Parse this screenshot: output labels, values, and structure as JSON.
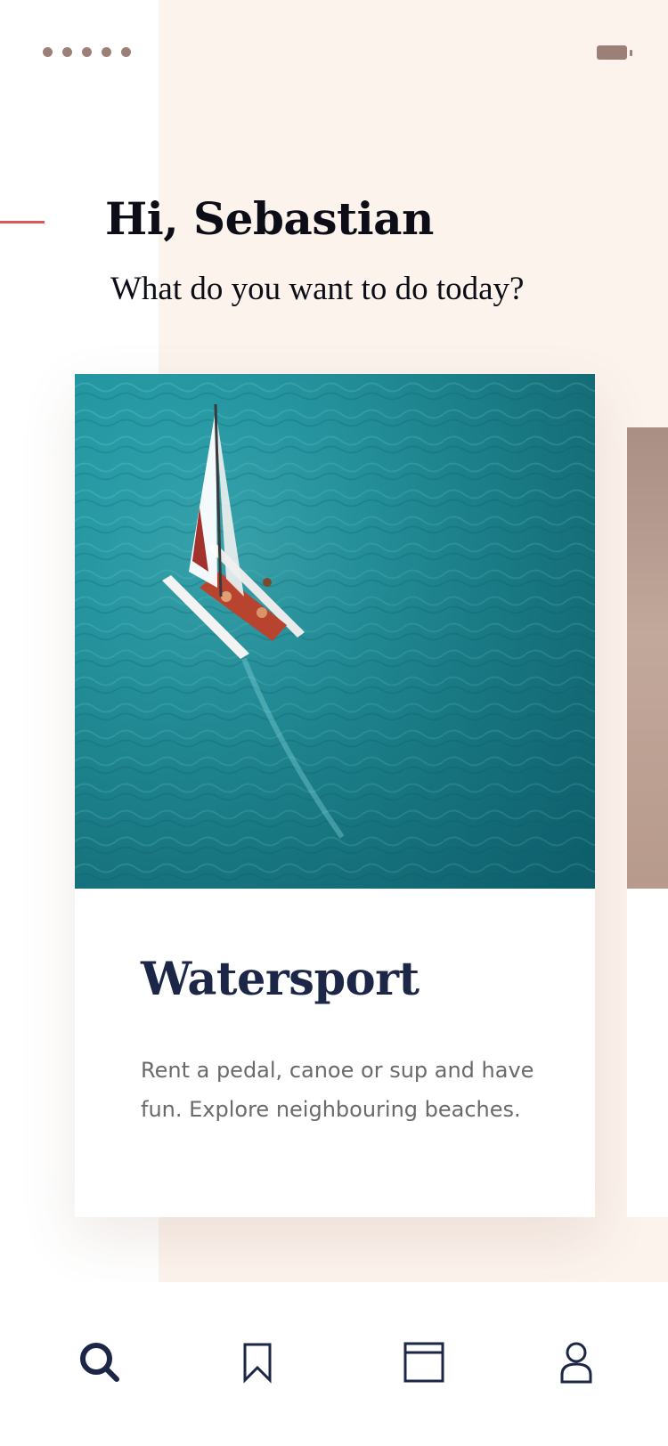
{
  "status_bar": {
    "signal_icon": "signal-dots-icon",
    "battery_icon": "battery-icon"
  },
  "header": {
    "greeting": "Hi, Sebastian",
    "subheading": "What do you want to do today?"
  },
  "cards": [
    {
      "image_icon": "catamaran-sailing-photo",
      "title": "Watersport",
      "description": "Rent a pedal, canoe or sup and have fun. Explore neighbouring beaches."
    }
  ],
  "tab_bar": {
    "tabs": [
      {
        "icon": "search-icon",
        "active": true
      },
      {
        "icon": "bookmark-icon",
        "active": false
      },
      {
        "icon": "calendar-icon",
        "active": false
      },
      {
        "icon": "profile-icon",
        "active": false
      }
    ]
  },
  "colors": {
    "background_peach": "#fcf3ed",
    "accent_red": "#d85a5a",
    "navy": "#1c2747",
    "text_dark": "#0c0d16",
    "text_muted": "#6a6a6a",
    "status_brown": "#9c8078"
  }
}
